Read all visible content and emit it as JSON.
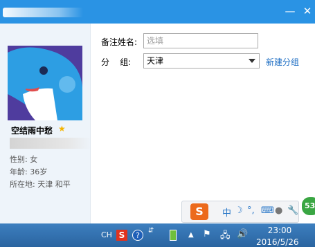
{
  "titlebar": {
    "minimize_label": "—",
    "close_label": "✕"
  },
  "profile": {
    "name": "空结雨中愁",
    "gender": "性别: 女",
    "age": "年龄: 36岁",
    "location": "所在地: 天津  和平"
  },
  "form": {
    "remark_label": "备注姓名:",
    "remark_placeholder": "选填",
    "group_label": "分    组:",
    "group_value": "天津",
    "new_group_link": "新建分组"
  },
  "ime": {
    "logo": "S",
    "chinese_label": "中",
    "punct_label": "°,"
  },
  "floating_badge": "53",
  "taskbar": {
    "lang": "CH",
    "time": "23:00",
    "date": "2016/5/26"
  }
}
